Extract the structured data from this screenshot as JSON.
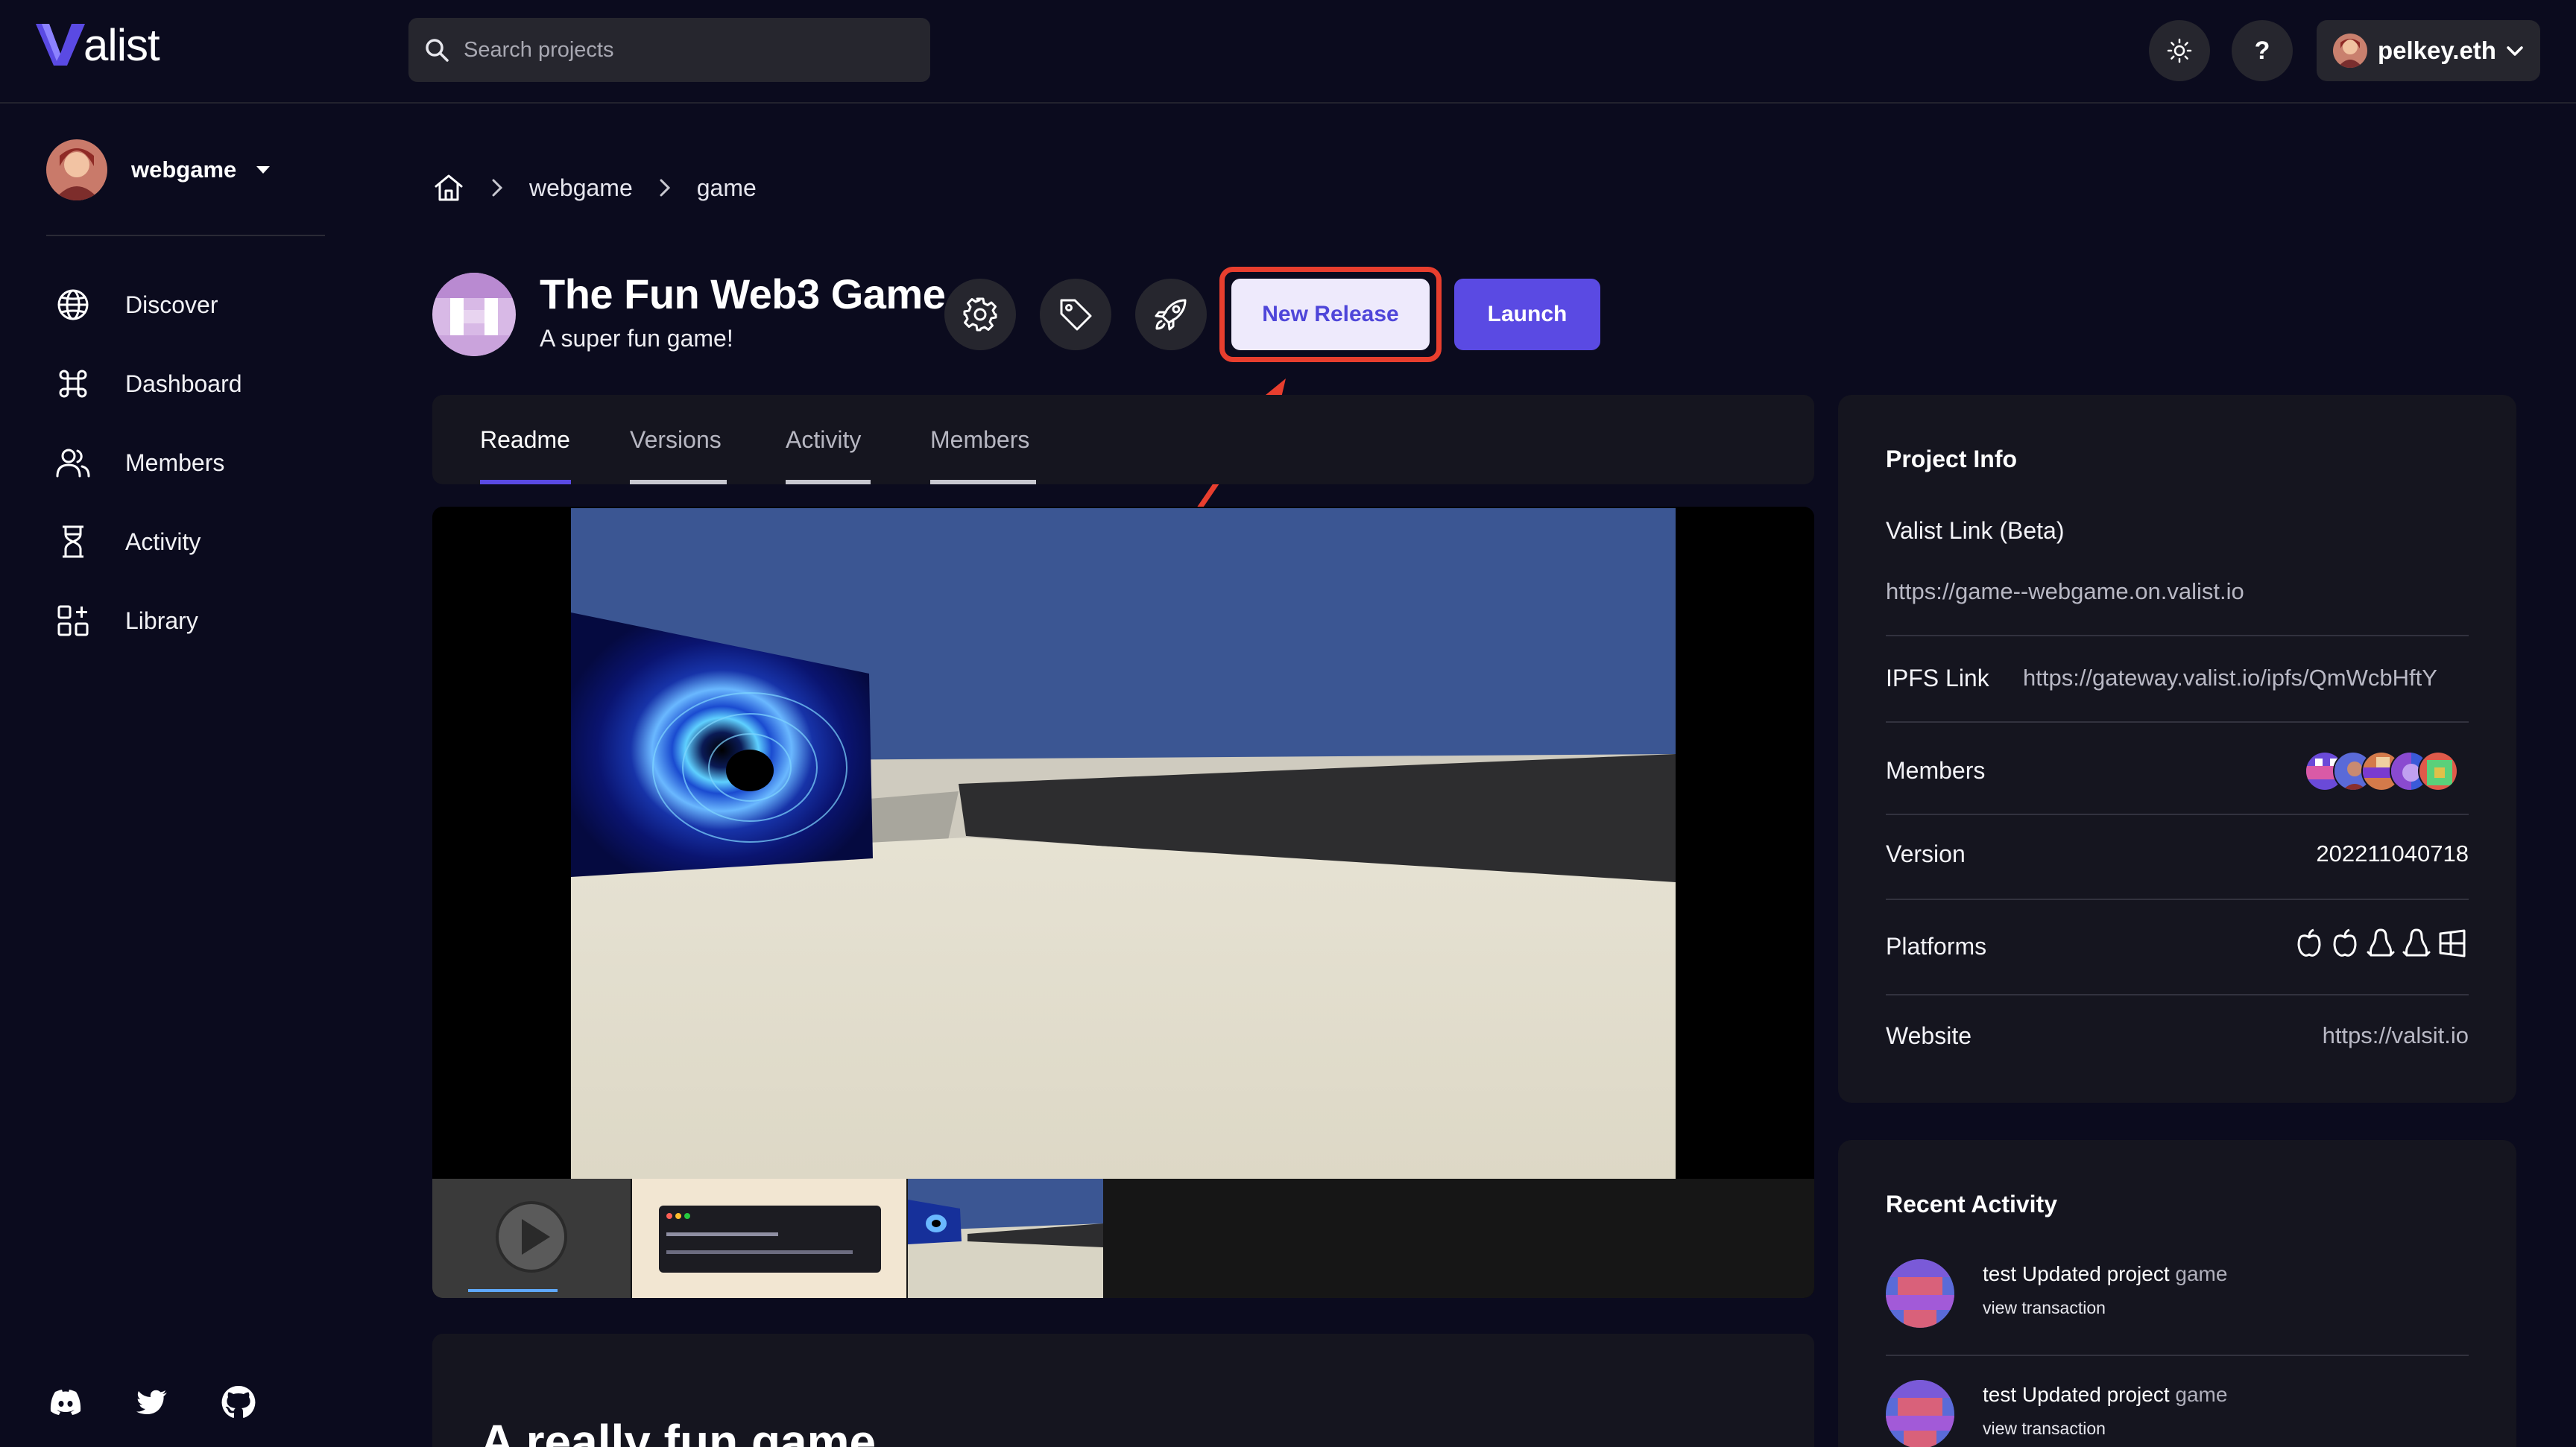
{
  "app": {
    "logo_text": "alist"
  },
  "search": {
    "placeholder": "Search projects"
  },
  "topbar": {
    "help_label": "?",
    "account_name": "pelkey.eth"
  },
  "workspace": {
    "name": "webgame"
  },
  "sidebar": {
    "items": [
      {
        "label": "Discover",
        "icon": "globe-icon"
      },
      {
        "label": "Dashboard",
        "icon": "command-icon"
      },
      {
        "label": "Members",
        "icon": "users-icon"
      },
      {
        "label": "Activity",
        "icon": "hourglass-icon"
      },
      {
        "label": "Library",
        "icon": "apps-icon"
      }
    ],
    "social": [
      "discord-icon",
      "twitter-icon",
      "github-icon"
    ]
  },
  "breadcrumb": {
    "items": [
      "webgame",
      "game"
    ]
  },
  "project": {
    "title": "The Fun Web3 Game",
    "subtitle": "A super fun game!",
    "new_release_label": "New Release",
    "launch_label": "Launch"
  },
  "tabs": [
    {
      "label": "Readme",
      "active": true
    },
    {
      "label": "Versions",
      "active": false
    },
    {
      "label": "Activity",
      "active": false
    },
    {
      "label": "Members",
      "active": false
    }
  ],
  "readme": {
    "heading": "A really fun game"
  },
  "project_info": {
    "title": "Project Info",
    "valist_link_label": "Valist Link (Beta)",
    "valist_link": "https://game--webgame.on.valist.io",
    "ipfs_label": "IPFS Link",
    "ipfs_link": "https://gateway.valist.io/ipfs/QmWcbHftY",
    "members_label": "Members",
    "version_label": "Version",
    "version": "202211040718",
    "platforms_label": "Platforms",
    "platforms": [
      "apple-icon",
      "apple-icon",
      "linux-icon",
      "linux-icon",
      "windows-icon"
    ],
    "website_label": "Website",
    "website": "https://valsit.io"
  },
  "recent_activity": {
    "title": "Recent Activity",
    "items": [
      {
        "actor": "test",
        "action": "Updated project",
        "project": "game",
        "link": "view transaction"
      },
      {
        "actor": "test",
        "action": "Updated project",
        "project": "game",
        "link": "view transaction"
      }
    ]
  },
  "colors": {
    "background": "#0b0b1e",
    "surface": "#15151f",
    "accent": "#5a4ae3",
    "highlight": "#e83e2e"
  }
}
